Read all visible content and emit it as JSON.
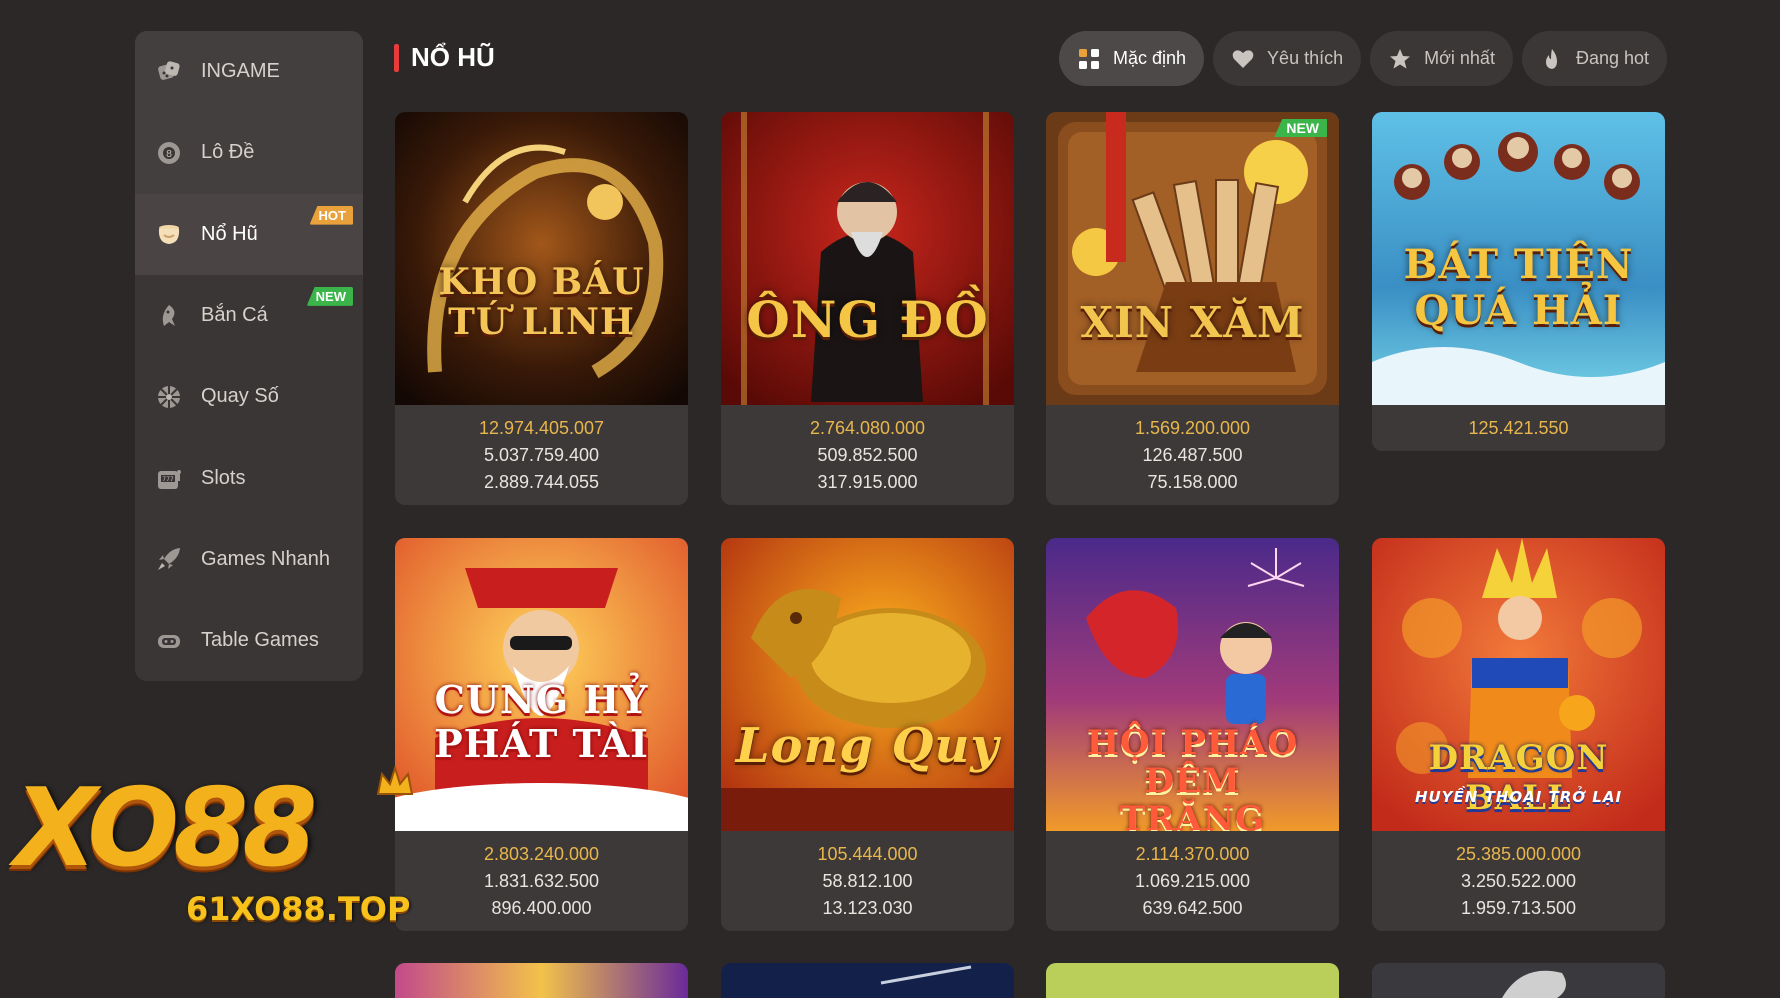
{
  "sidebar": {
    "items": [
      {
        "label": "INGAME",
        "icon": "dice-icon",
        "badge": ""
      },
      {
        "label": "Lô Đề",
        "icon": "lottery-ball-icon",
        "badge": ""
      },
      {
        "label": "Nổ Hũ",
        "icon": "jackpot-pot-icon",
        "badge": "HOT"
      },
      {
        "label": "Bắn Cá",
        "icon": "fish-icon",
        "badge": "NEW"
      },
      {
        "label": "Quay Số",
        "icon": "wheel-icon",
        "badge": ""
      },
      {
        "label": "Slots",
        "icon": "slot-machine-icon",
        "badge": ""
      },
      {
        "label": "Games Nhanh",
        "icon": "rocket-icon",
        "badge": ""
      },
      {
        "label": "Table Games",
        "icon": "gamepad-icon",
        "badge": ""
      }
    ],
    "active_index": 2
  },
  "header": {
    "title": "NỔ HŨ",
    "filters": [
      {
        "label": "Mặc định",
        "icon": "grid-icon"
      },
      {
        "label": "Yêu thích",
        "icon": "heart-icon"
      },
      {
        "label": "Mới nhất",
        "icon": "star-icon"
      },
      {
        "label": "Đang hot",
        "icon": "flame-icon"
      }
    ]
  },
  "games": [
    {
      "title": "KHO BÁU TỨ LINH",
      "badge": "",
      "jackpots": [
        "12.974.405.007",
        "5.037.759.400",
        "2.889.744.055"
      ]
    },
    {
      "title": "ÔNG ĐỒ",
      "badge": "",
      "jackpots": [
        "2.764.080.000",
        "509.852.500",
        "317.915.000"
      ]
    },
    {
      "title": "XIN XĂM",
      "badge": "NEW",
      "jackpots": [
        "1.569.200.000",
        "126.487.500",
        "75.158.000"
      ]
    },
    {
      "title": "BÁT TIÊN QUÁ HẢI",
      "badge": "",
      "jackpots": [
        "125.421.550"
      ]
    },
    {
      "title": "CUNG HỶ PHÁT TÀI",
      "badge": "",
      "jackpots": [
        "2.803.240.000",
        "1.831.632.500",
        "896.400.000"
      ]
    },
    {
      "title": "Long Quy",
      "badge": "",
      "jackpots": [
        "105.444.000",
        "58.812.100",
        "13.123.030"
      ]
    },
    {
      "title": "HỘI PHÁO ĐÊM TRĂNG",
      "badge": "",
      "jackpots": [
        "2.114.370.000",
        "1.069.215.000",
        "639.642.500"
      ]
    },
    {
      "title": "DRAGON BALL",
      "subtitle": "HUYỀN THOẠI TRỞ LẠI",
      "badge": "",
      "jackpots": [
        "25.385.000.000",
        "3.250.522.000",
        "1.959.713.500"
      ]
    }
  ],
  "watermark": {
    "logo_text": "XO88",
    "site": "61XO88.TOP"
  },
  "colors": {
    "background": "#2b2827",
    "jackpot_primary": "#e8b64c",
    "hot_badge": "#e9a23b",
    "new_badge": "#3bb54a",
    "title_accent": "#e83b3b"
  }
}
